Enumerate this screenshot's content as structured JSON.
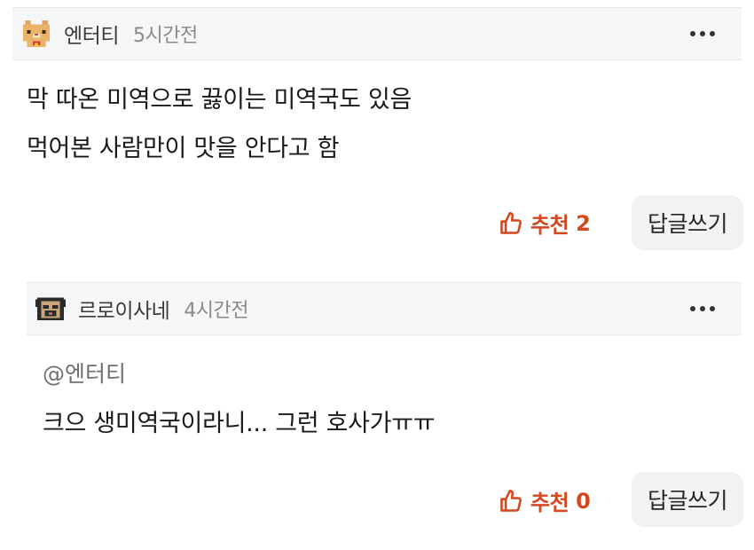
{
  "comments": [
    {
      "author": "엔터티",
      "time": "5시간전",
      "avatar_icon": "cat-pixel-avatar-icon",
      "lines": [
        "막 따온 미역으로 끓이는 미역국도 있음",
        "먹어본 사람만이 맛을 안다고 함"
      ],
      "recommend_label": "추천",
      "recommend_count": "2",
      "reply_label": "답글쓰기"
    },
    {
      "author": "르로이사네",
      "time": "4시간전",
      "avatar_icon": "pug-pixel-avatar-icon",
      "mention": "@엔터티",
      "lines": [
        "크으 생미역국이라니... 그런 호사가ㅠㅠ"
      ],
      "recommend_label": "추천",
      "recommend_count": "0",
      "reply_label": "답글쓰기"
    }
  ],
  "colors": {
    "accent": "#d4471f",
    "header_bg": "#f5f6f7",
    "button_bg": "#f1f2f3"
  }
}
